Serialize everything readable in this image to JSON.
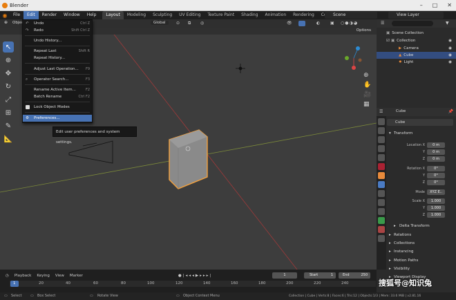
{
  "window": {
    "title": "Blender"
  },
  "menu": [
    "File",
    "Edit",
    "Render",
    "Window",
    "Help"
  ],
  "workspaces": [
    "Layout",
    "Modeling",
    "Sculpting",
    "UV Editing",
    "Texture Paint",
    "Shading",
    "Animation",
    "Rendering",
    "Composit"
  ],
  "scene": {
    "label": "Scene"
  },
  "view_layer": {
    "label": "View Layer"
  },
  "viewport_header": {
    "mode": "Object",
    "orientation": "Global",
    "options": "Options"
  },
  "edit_menu": {
    "items": [
      {
        "label": "Undo",
        "shortcut": "Ctrl Z"
      },
      {
        "label": "Redo",
        "shortcut": "Shift Ctrl Z"
      },
      {
        "label": "Undo History...",
        "shortcut": ""
      },
      {
        "label": "Repeat Last",
        "shortcut": "Shift R"
      },
      {
        "label": "Repeat History...",
        "shortcut": ""
      },
      {
        "label": "Adjust Last Operation...",
        "shortcut": "F9"
      },
      {
        "label": "Operator Search...",
        "shortcut": "F3"
      },
      {
        "label": "Rename Active Item...",
        "shortcut": "F2"
      },
      {
        "label": "Batch Rename",
        "shortcut": "Ctrl F2"
      },
      {
        "label": "Lock Object Modes",
        "shortcut": ""
      },
      {
        "label": "Preferences...",
        "shortcut": ""
      }
    ]
  },
  "tooltip": {
    "text": "Edit user preferences and system settings."
  },
  "outliner": {
    "rows": [
      {
        "label": "Scene Collection"
      },
      {
        "label": "Collection"
      },
      {
        "label": "Camera"
      },
      {
        "label": "Cube"
      },
      {
        "label": "Light"
      }
    ]
  },
  "properties": {
    "object_name": "Cube",
    "data_name": "Cube",
    "transform_label": "Transform",
    "location_label": "Location X",
    "rotation_label": "Rotation X",
    "scale_label": "Scale X",
    "mode_label": "Mode",
    "axis_y": "Y",
    "axis_z": "Z",
    "location": [
      "0 m",
      "0 m",
      "0 m"
    ],
    "rotation": [
      "0°",
      "0°",
      "0°"
    ],
    "mode": "XYZ E..",
    "scale": [
      "1.000",
      "1.000",
      "1.000"
    ],
    "delta": "Delta Transform",
    "sections": [
      "Relations",
      "Collections",
      "Instancing",
      "Motion Paths",
      "Visibility",
      "Viewport Display"
    ]
  },
  "timeline": {
    "playback": "Playback",
    "keying": "Keying",
    "view": "View",
    "marker": "Marker",
    "current_frame": "1",
    "start_label": "Start",
    "start": "1",
    "end_label": "End",
    "end": "250",
    "ruler": [
      "1",
      "20",
      "40",
      "60",
      "80",
      "100",
      "120",
      "140",
      "160",
      "180",
      "200",
      "220",
      "240"
    ]
  },
  "status": {
    "select": "Select",
    "box": "Box Select",
    "rotate": "Rotate View",
    "context": "Object Context Menu",
    "stats": "Collection | Cube | Verts:8 | Faces:6 | Tris:12 | Objects:1/3 | Mem: 33.6 MiB | v2.81.16"
  },
  "watermark": "搜狐号@知识兔"
}
